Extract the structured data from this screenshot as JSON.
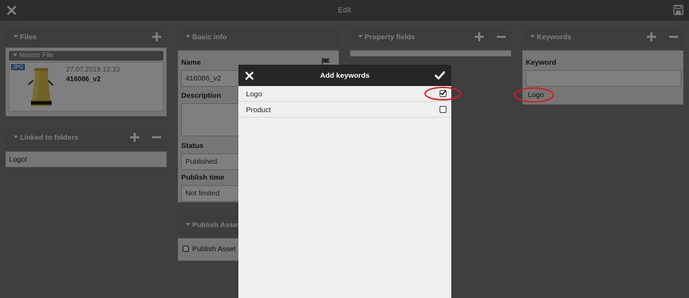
{
  "topbar": {
    "title": "Edit"
  },
  "files": {
    "title": "Files",
    "master_label": "Master File",
    "file_type": "JPG",
    "date": "27.07.2018 12:33",
    "filename": "416086_v2"
  },
  "folders": {
    "title": "Linked to folders",
    "items": [
      "Logot"
    ]
  },
  "basic_info": {
    "title": "Basic info",
    "name_label": "Name",
    "name_value": "416086_v2",
    "description_label": "Description",
    "description_value": "",
    "status_label": "Status",
    "status_value": "Published",
    "publish_time_label": "Publish time",
    "publish_time_value": "Not limited"
  },
  "publish_asset": {
    "title": "Publish Asset",
    "checkbox_label": "Publish Asset",
    "checked": false
  },
  "property_fields": {
    "title": "Property fields"
  },
  "keywords": {
    "title": "Keywords",
    "keyword_label": "Keyword",
    "keyword_input": "",
    "selected": [
      "Logo"
    ]
  },
  "modal": {
    "title": "Add keywords",
    "options": [
      {
        "label": "Logo",
        "checked": true
      },
      {
        "label": "Product",
        "checked": false
      }
    ]
  },
  "colors": {
    "header": "#595959",
    "panel_header": "#7a7a7a",
    "modal_header": "#262626",
    "highlight": "#e0151b",
    "file_badge": "#3d7cc9"
  }
}
